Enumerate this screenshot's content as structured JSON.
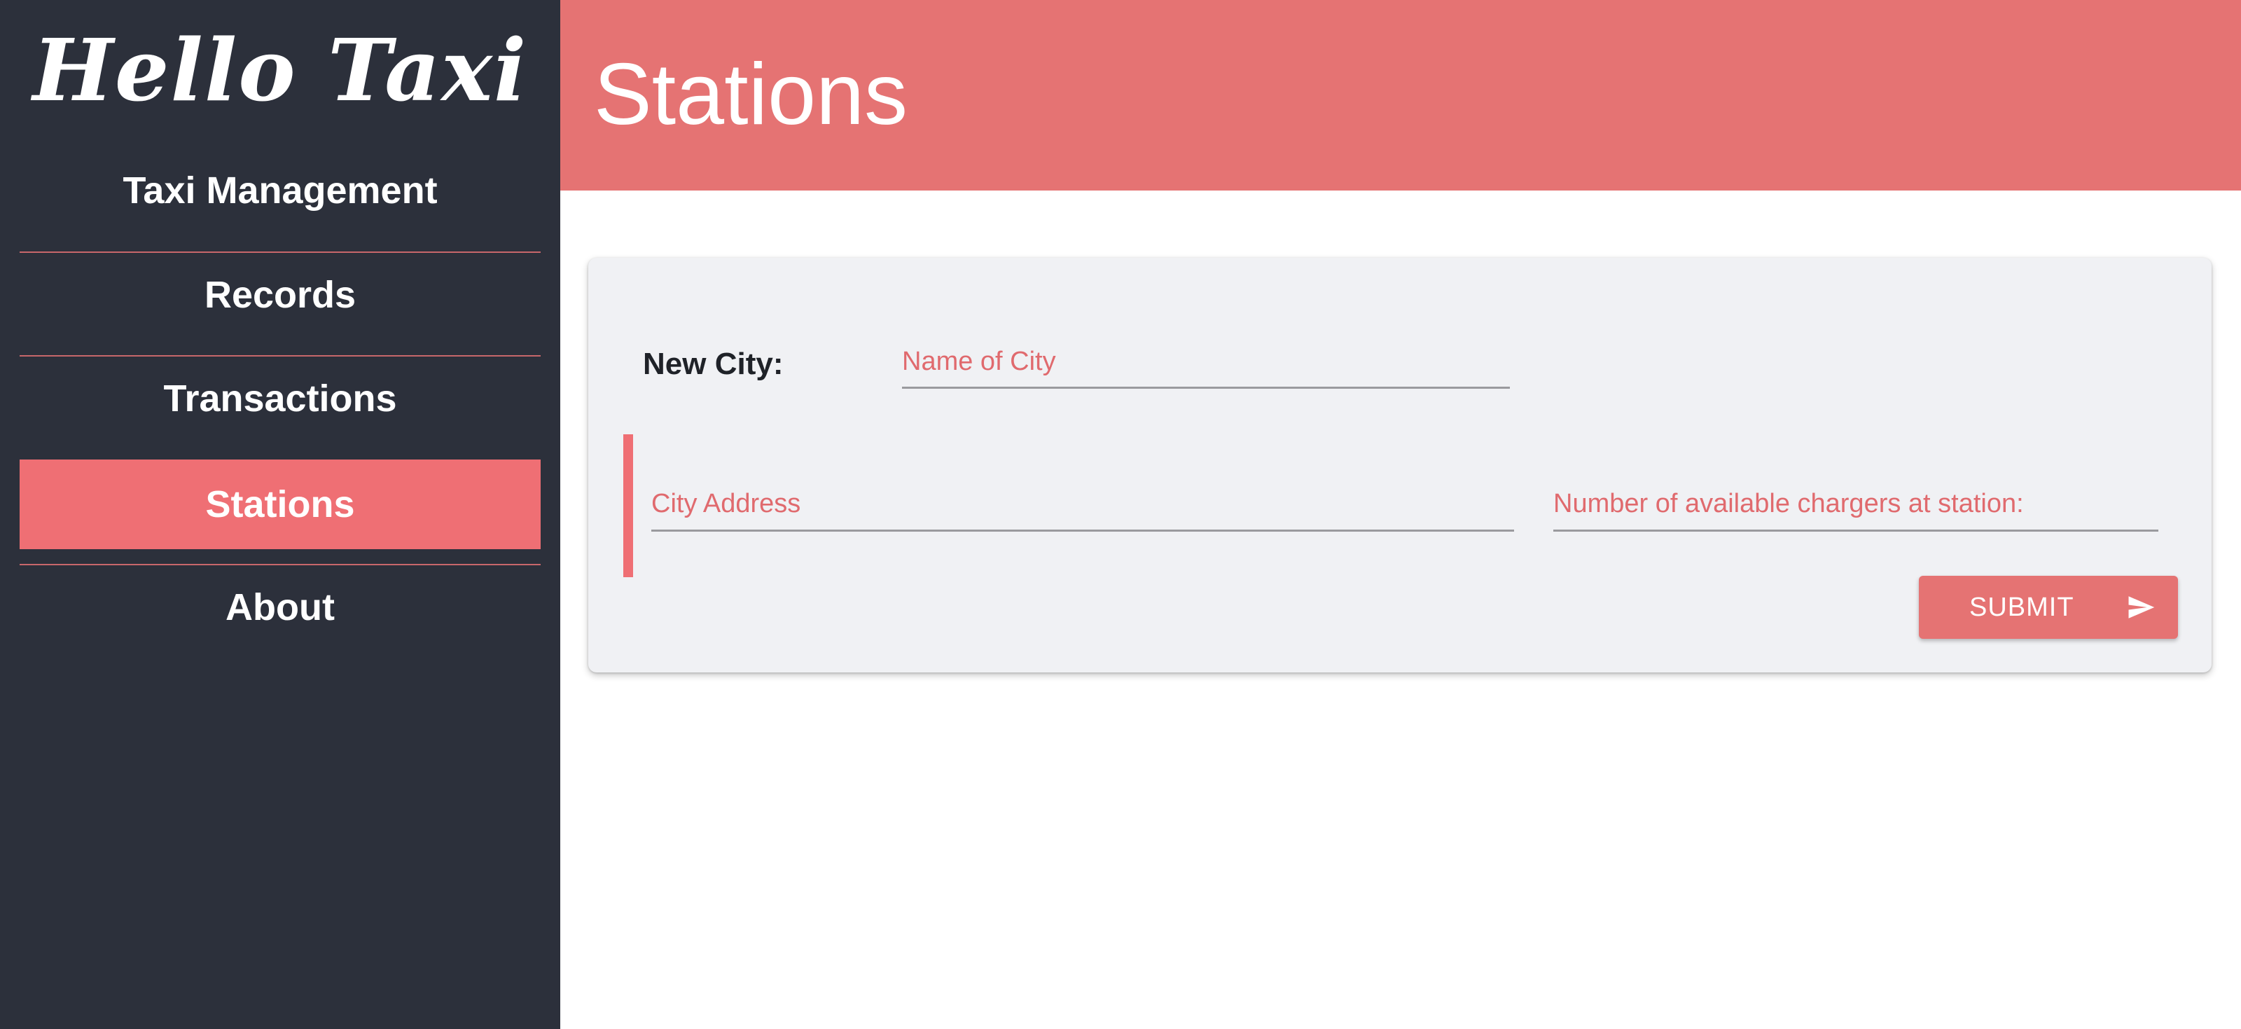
{
  "app": {
    "title": "Hello Taxi"
  },
  "sidebar": {
    "items": [
      {
        "label": "Taxi Management"
      },
      {
        "label": "Records"
      },
      {
        "label": "Transactions"
      },
      {
        "label": "Stations",
        "active": true
      },
      {
        "label": "About"
      }
    ]
  },
  "header": {
    "title": "Stations"
  },
  "form": {
    "city_label": "New City:",
    "city_name": {
      "value": "",
      "placeholder": "Name of City"
    },
    "city_address": {
      "value": "",
      "placeholder": "City Address"
    },
    "chargers": {
      "value": "",
      "placeholder": "Number of available chargers at station:"
    },
    "submit_label": "SUBMIT",
    "submit_icon": "send-icon"
  },
  "colors": {
    "sidebar_bg": "#2c303b",
    "accent": "#e57373",
    "active_item": "#ef6f74",
    "card_bg": "#f0f1f4"
  }
}
